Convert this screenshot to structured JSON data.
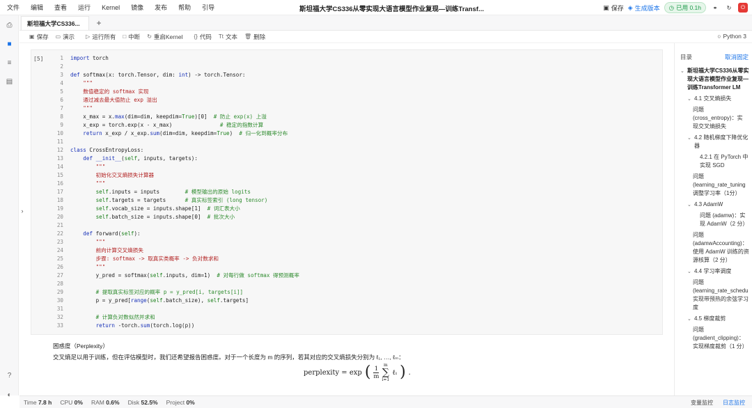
{
  "menu": [
    "文件",
    "编辑",
    "查看",
    "运行",
    "Kernel",
    "镜像",
    "发布",
    "帮助",
    "引导"
  ],
  "doc_title": "斯坦福大学CS336从零实现大语言模型作业复现—训练Transf...",
  "top_right": {
    "save": "保存",
    "generate": "生成版本",
    "running": "已用 0.1h"
  },
  "tab_label": "斯坦福大学CS336...",
  "toolbar": [
    "保存",
    "演示",
    "运行所有",
    "中断",
    "重启Kernel",
    "代码",
    "文本",
    "删除"
  ],
  "kernel": "Python 3",
  "cell_prompt": "[5]",
  "code_lines": [
    [
      {
        "t": "import",
        "c": "k"
      },
      {
        "t": " torch",
        "c": ""
      }
    ],
    [],
    [
      {
        "t": "def",
        "c": "k"
      },
      {
        "t": " softmax(x: torch.Tensor, dim: ",
        "c": ""
      },
      {
        "t": "int",
        "c": "b"
      },
      {
        "t": ") -> torch.Tensor:",
        "c": ""
      }
    ],
    [
      {
        "t": "    \"\"\"",
        "c": "s"
      }
    ],
    [
      {
        "t": "    数值稳定的 softmax 实现",
        "c": "s"
      }
    ],
    [
      {
        "t": "    通过减去最大值防止 exp 溢出",
        "c": "s"
      }
    ],
    [
      {
        "t": "    \"\"\"",
        "c": "s"
      }
    ],
    [
      {
        "t": "    x_max = x.",
        "c": ""
      },
      {
        "t": "max",
        "c": "b"
      },
      {
        "t": "(dim=dim, keepdim=",
        "c": ""
      },
      {
        "t": "True",
        "c": "n"
      },
      {
        "t": ")[0]  ",
        "c": ""
      },
      {
        "t": "# 防止 exp(x) 上溢",
        "c": "c"
      }
    ],
    [
      {
        "t": "    x_exp = torch.exp(x - x_max)               ",
        "c": ""
      },
      {
        "t": "# 稳定的指数计算",
        "c": "c"
      }
    ],
    [
      {
        "t": "    ",
        "c": ""
      },
      {
        "t": "return",
        "c": "k"
      },
      {
        "t": " x_exp / x_exp.",
        "c": ""
      },
      {
        "t": "sum",
        "c": "b"
      },
      {
        "t": "(dim=dim, keepdim=",
        "c": ""
      },
      {
        "t": "True",
        "c": "n"
      },
      {
        "t": ")  ",
        "c": ""
      },
      {
        "t": "# 归一化到概率分布",
        "c": "c"
      }
    ],
    [],
    [
      {
        "t": "class",
        "c": "k"
      },
      {
        "t": " CrossEntropyLoss:",
        "c": ""
      }
    ],
    [
      {
        "t": "    ",
        "c": ""
      },
      {
        "t": "def",
        "c": "k"
      },
      {
        "t": " __init__",
        "c": "b"
      },
      {
        "t": "(",
        "c": ""
      },
      {
        "t": "self",
        "c": "n"
      },
      {
        "t": ", inputs, targets):",
        "c": ""
      }
    ],
    [
      {
        "t": "        \"\"\"",
        "c": "s"
      }
    ],
    [
      {
        "t": "        初始化交叉熵损失计算器",
        "c": "s"
      }
    ],
    [
      {
        "t": "        \"\"\"",
        "c": "s"
      }
    ],
    [
      {
        "t": "        ",
        "c": ""
      },
      {
        "t": "self",
        "c": "n"
      },
      {
        "t": ".inputs = inputs        ",
        "c": ""
      },
      {
        "t": "# 模型输出的原始 logits",
        "c": "c"
      }
    ],
    [
      {
        "t": "        ",
        "c": ""
      },
      {
        "t": "self",
        "c": "n"
      },
      {
        "t": ".targets = targets      ",
        "c": ""
      },
      {
        "t": "# 真实标签索引 (long tensor)",
        "c": "c"
      }
    ],
    [
      {
        "t": "        ",
        "c": ""
      },
      {
        "t": "self",
        "c": "n"
      },
      {
        "t": ".vocab_size = inputs.shape[1]  ",
        "c": ""
      },
      {
        "t": "# 词汇表大小",
        "c": "c"
      }
    ],
    [
      {
        "t": "        ",
        "c": ""
      },
      {
        "t": "self",
        "c": "n"
      },
      {
        "t": ".batch_size = inputs.shape[0]  ",
        "c": ""
      },
      {
        "t": "# 批次大小",
        "c": "c"
      }
    ],
    [],
    [
      {
        "t": "    ",
        "c": ""
      },
      {
        "t": "def",
        "c": "k"
      },
      {
        "t": " forward(",
        "c": ""
      },
      {
        "t": "self",
        "c": "n"
      },
      {
        "t": "):",
        "c": ""
      }
    ],
    [
      {
        "t": "        \"\"\"",
        "c": "s"
      }
    ],
    [
      {
        "t": "        前向计算交叉熵损失",
        "c": "s"
      }
    ],
    [
      {
        "t": "        步骤: softmax -> 取真实类概率 -> 负对数求和",
        "c": "s"
      }
    ],
    [
      {
        "t": "        \"\"\"",
        "c": "s"
      }
    ],
    [
      {
        "t": "        y_pred = softmax(",
        "c": ""
      },
      {
        "t": "self",
        "c": "n"
      },
      {
        "t": ".inputs, dim=1)  ",
        "c": ""
      },
      {
        "t": "# 对每行做 softmax 得预测概率",
        "c": "c"
      }
    ],
    [],
    [
      {
        "t": "        ",
        "c": ""
      },
      {
        "t": "# 提取真实标签对应的概率 p = y_pred[i, targets[i]]",
        "c": "c"
      }
    ],
    [
      {
        "t": "        p = y_pred[",
        "c": ""
      },
      {
        "t": "range",
        "c": "b"
      },
      {
        "t": "(",
        "c": ""
      },
      {
        "t": "self",
        "c": "n"
      },
      {
        "t": ".batch_size), ",
        "c": ""
      },
      {
        "t": "self",
        "c": "n"
      },
      {
        "t": ".targets]",
        "c": ""
      }
    ],
    [],
    [
      {
        "t": "        ",
        "c": ""
      },
      {
        "t": "# 计算负对数似然并求和",
        "c": "c"
      }
    ],
    [
      {
        "t": "        ",
        "c": ""
      },
      {
        "t": "return",
        "c": "k"
      },
      {
        "t": " -torch.",
        "c": ""
      },
      {
        "t": "sum",
        "c": "b"
      },
      {
        "t": "(torch.log(p))",
        "c": ""
      }
    ]
  ],
  "markdown": {
    "heading": "困惑度（Perplexity）",
    "text": "交叉熵足以用于训练，但在评估模型时，我们还希望报告困惑度。对于一个长度为 m 的序列，若其对应的交叉熵损失分别为 ℓ₁, …, ℓₘ：",
    "formula_lhs": "perplexity = exp",
    "formula_num": "1",
    "formula_den": "m",
    "formula_sum": "∑",
    "formula_sup": "m",
    "formula_sub": "i=1",
    "formula_term": "ℓᵢ",
    "formula_end": "."
  },
  "toc": {
    "title": "目录",
    "unpin": "取消固定",
    "items": [
      {
        "text": "斯坦福大学CS336从零实",
        "bold": true
      },
      {
        "text": "现大语言模型作业复现—",
        "bold": true
      },
      {
        "text": "训练Transformer LM",
        "bold": true
      },
      {
        "text": "4.1 交叉熵损失"
      },
      {
        "text": "问题"
      },
      {
        "text": "(cross_entropy)：实"
      },
      {
        "text": "现交叉熵损失"
      },
      {
        "text": "4.2 随机梯度下降优化"
      },
      {
        "text": "器"
      },
      {
        "text": "4.2.1 在 PyTorch 中"
      },
      {
        "text": "实现 SGD"
      },
      {
        "text": "问题"
      },
      {
        "text": "(learning_rate_tuning"
      },
      {
        "text": "调整学习率（1分）"
      },
      {
        "text": "4.3 AdamW"
      },
      {
        "text": "问题 (adamw)：实"
      },
      {
        "text": "现 AdamW（2 分）"
      },
      {
        "text": "问题"
      },
      {
        "text": "(adamwAccounting)："
      },
      {
        "text": "使用 AdamW 训练的资"
      },
      {
        "text": "源核算（2 分）"
      },
      {
        "text": "4.4 学习率调度"
      },
      {
        "text": "问题"
      },
      {
        "text": "(learning_rate_schedu"
      },
      {
        "text": "实现带预热的余弦学习"
      },
      {
        "text": "度"
      },
      {
        "text": "4.5 梯度裁剪"
      },
      {
        "text": "问题"
      },
      {
        "text": "(gradient_clipping)："
      },
      {
        "text": "实现梯度裁剪（1 分）"
      }
    ]
  },
  "status": {
    "time_label": "Time",
    "time": "7.8 h",
    "cpu_label": "CPU",
    "cpu": "0%",
    "ram_label": "RAM",
    "ram": "0.6%",
    "disk_label": "Disk",
    "disk": "52.5%",
    "project_label": "Project",
    "project": "0%",
    "var_monitor": "变量监控",
    "log_monitor": "日志监控"
  }
}
